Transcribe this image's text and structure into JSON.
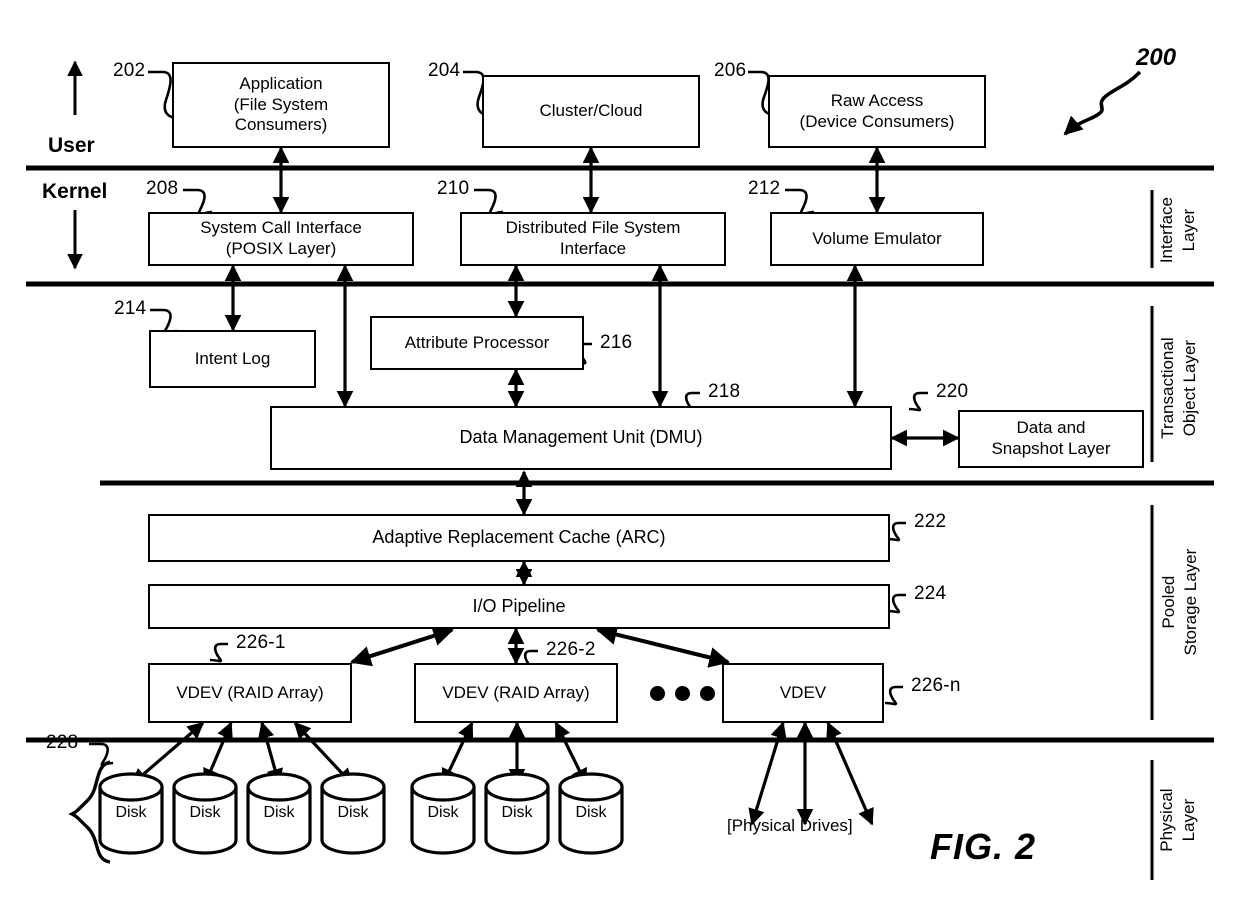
{
  "figure": {
    "caption": "FIG. 2",
    "system_ref": "200"
  },
  "axis_labels": {
    "user": "User",
    "kernel": "Kernel"
  },
  "layer_labels": [
    {
      "ref": "interface",
      "line1": "Interface",
      "line2": "Layer"
    },
    {
      "ref": "transactional",
      "line1": "Transactional",
      "line2": "Object Layer"
    },
    {
      "ref": "pooled",
      "line1": "Pooled",
      "line2": "Storage Layer"
    },
    {
      "ref": "physical",
      "line1": "Physical",
      "line2": "Layer"
    }
  ],
  "boxes": {
    "application": {
      "ref": "202",
      "lines": [
        "Application",
        "(File System",
        "Consumers)"
      ]
    },
    "cluster_cloud": {
      "ref": "204",
      "lines": [
        "Cluster/Cloud"
      ]
    },
    "raw_access": {
      "ref": "206",
      "lines": [
        "Raw Access",
        "(Device Consumers)"
      ]
    },
    "system_call_interface": {
      "ref": "208",
      "lines": [
        "System Call Interface",
        "(POSIX Layer)"
      ]
    },
    "distributed_fs_interface": {
      "ref": "210",
      "lines": [
        "Distributed File System",
        "Interface"
      ]
    },
    "volume_emulator": {
      "ref": "212",
      "lines": [
        "Volume Emulator"
      ]
    },
    "intent_log": {
      "ref": "214",
      "lines": [
        "Intent Log"
      ]
    },
    "attribute_processor": {
      "ref": "216",
      "lines": [
        "Attribute Processor"
      ]
    },
    "dmu": {
      "ref": "218",
      "lines": [
        "Data Management Unit (DMU)"
      ]
    },
    "data_snapshot_layer": {
      "ref": "220",
      "lines": [
        "Data and",
        "Snapshot Layer"
      ]
    },
    "arc": {
      "ref": "222",
      "lines": [
        "Adaptive Replacement Cache (ARC)"
      ]
    },
    "io_pipeline": {
      "ref": "224",
      "lines": [
        "I/O Pipeline"
      ]
    },
    "vdev_1": {
      "ref": "226-1",
      "lines": [
        "VDEV (RAID Array)"
      ]
    },
    "vdev_2": {
      "ref": "226-2",
      "lines": [
        "VDEV (RAID Array)"
      ]
    },
    "vdev_n": {
      "ref": "226-n",
      "lines": [
        "VDEV"
      ]
    }
  },
  "disks": {
    "ref": "228",
    "label": "Disk",
    "group1_count": 4,
    "group2_count": 3,
    "physical_drives_label": "[Physical Drives]"
  },
  "colors": {
    "ink": "#000000",
    "paper": "#ffffff"
  }
}
